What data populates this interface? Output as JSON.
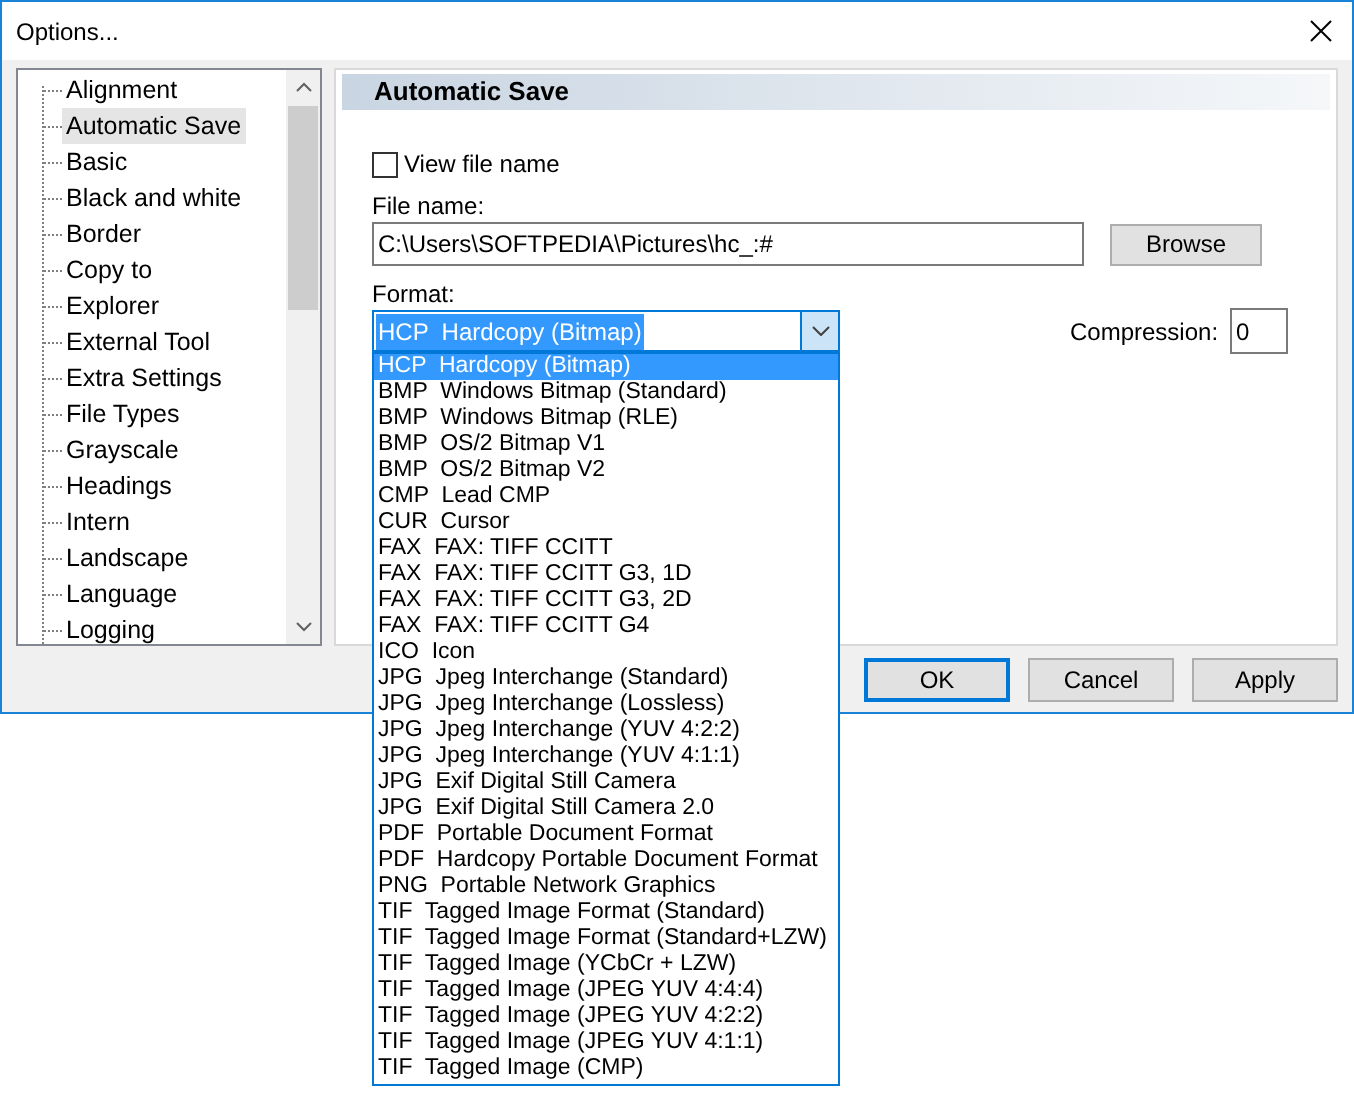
{
  "window": {
    "title": "Options..."
  },
  "tree": {
    "items": [
      {
        "label": "Alignment",
        "selected": false
      },
      {
        "label": "Automatic Save",
        "selected": true
      },
      {
        "label": "Basic",
        "selected": false
      },
      {
        "label": "Black and white",
        "selected": false
      },
      {
        "label": "Border",
        "selected": false
      },
      {
        "label": "Copy to",
        "selected": false
      },
      {
        "label": "Explorer",
        "selected": false
      },
      {
        "label": "External Tool",
        "selected": false
      },
      {
        "label": "Extra Settings",
        "selected": false
      },
      {
        "label": "File Types",
        "selected": false
      },
      {
        "label": "Grayscale",
        "selected": false
      },
      {
        "label": "Headings",
        "selected": false
      },
      {
        "label": "Intern",
        "selected": false
      },
      {
        "label": "Landscape",
        "selected": false
      },
      {
        "label": "Language",
        "selected": false
      },
      {
        "label": "Logging",
        "selected": false
      }
    ]
  },
  "panel": {
    "title": "Automatic Save",
    "view_file_name": {
      "label": "View file name",
      "checked": false
    },
    "file_name": {
      "label": "File name:",
      "value": "C:\\Users\\SOFTPEDIA\\Pictures\\hc_:#"
    },
    "browse_button": "Browse",
    "format": {
      "label": "Format:",
      "value": "HCP  Hardcopy (Bitmap)",
      "expanded": true,
      "options": [
        {
          "label": "HCP  Hardcopy (Bitmap)",
          "selected": true
        },
        {
          "label": "BMP  Windows Bitmap (Standard)",
          "selected": false
        },
        {
          "label": "BMP  Windows Bitmap (RLE)",
          "selected": false
        },
        {
          "label": "BMP  OS/2 Bitmap V1",
          "selected": false
        },
        {
          "label": "BMP  OS/2 Bitmap V2",
          "selected": false
        },
        {
          "label": "CMP  Lead CMP",
          "selected": false
        },
        {
          "label": "CUR  Cursor",
          "selected": false
        },
        {
          "label": "FAX  FAX: TIFF CCITT",
          "selected": false
        },
        {
          "label": "FAX  FAX: TIFF CCITT G3, 1D",
          "selected": false
        },
        {
          "label": "FAX  FAX: TIFF CCITT G3, 2D",
          "selected": false
        },
        {
          "label": "FAX  FAX: TIFF CCITT G4",
          "selected": false
        },
        {
          "label": "ICO  Icon",
          "selected": false
        },
        {
          "label": "JPG  Jpeg Interchange (Standard)",
          "selected": false
        },
        {
          "label": "JPG  Jpeg Interchange (Lossless)",
          "selected": false
        },
        {
          "label": "JPG  Jpeg Interchange (YUV 4:2:2)",
          "selected": false
        },
        {
          "label": "JPG  Jpeg Interchange (YUV 4:1:1)",
          "selected": false
        },
        {
          "label": "JPG  Exif Digital Still Camera",
          "selected": false
        },
        {
          "label": "JPG  Exif Digital Still Camera 2.0",
          "selected": false
        },
        {
          "label": "PDF  Portable Document Format",
          "selected": false
        },
        {
          "label": "PDF  Hardcopy Portable Document Format",
          "selected": false
        },
        {
          "label": "PNG  Portable Network Graphics",
          "selected": false
        },
        {
          "label": "TIF  Tagged Image Format (Standard)",
          "selected": false
        },
        {
          "label": "TIF  Tagged Image Format (Standard+LZW)",
          "selected": false
        },
        {
          "label": "TIF  Tagged Image (YCbCr + LZW)",
          "selected": false
        },
        {
          "label": "TIF  Tagged Image (JPEG YUV 4:4:4)",
          "selected": false
        },
        {
          "label": "TIF  Tagged Image (JPEG YUV 4:2:2)",
          "selected": false
        },
        {
          "label": "TIF  Tagged Image (JPEG YUV 4:1:1)",
          "selected": false
        },
        {
          "label": "TIF  Tagged Image (CMP)",
          "selected": false
        }
      ]
    },
    "compression": {
      "label": "Compression:",
      "value": "0"
    }
  },
  "buttons": [
    {
      "label": "OK",
      "default": true
    },
    {
      "label": "Cancel",
      "default": false
    },
    {
      "label": "Apply",
      "default": false
    }
  ]
}
